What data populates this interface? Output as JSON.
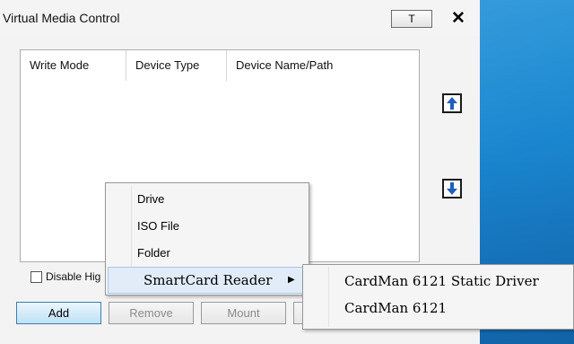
{
  "window": {
    "title": "Virtual Media Control",
    "pin_label": "T",
    "close_label": "✕"
  },
  "table": {
    "columns": [
      "Write Mode",
      "Device Type",
      "Device Name/Path"
    ],
    "rows": []
  },
  "side_buttons": {
    "up_icon": "arrow-up-icon",
    "down_icon": "arrow-down-icon"
  },
  "options": {
    "disable_label": "Disable Hig"
  },
  "footer": {
    "add_label": "Add",
    "remove_label": "Remove",
    "mount_label": "Mount"
  },
  "context_menu": {
    "items": [
      {
        "label": "Drive"
      },
      {
        "label": "ISO File"
      },
      {
        "label": "Folder"
      },
      {
        "label": "SmartCard Reader",
        "submenu_arrow": "▶"
      }
    ]
  },
  "submenu": {
    "items": [
      {
        "label": "CardMan 6121 Static Driver"
      },
      {
        "label": "CardMan 6121"
      }
    ]
  },
  "colors": {
    "accent_blue": "#1a86d0",
    "highlight": "#e1ecf8",
    "arrow_blue": "#1f5fbf"
  }
}
